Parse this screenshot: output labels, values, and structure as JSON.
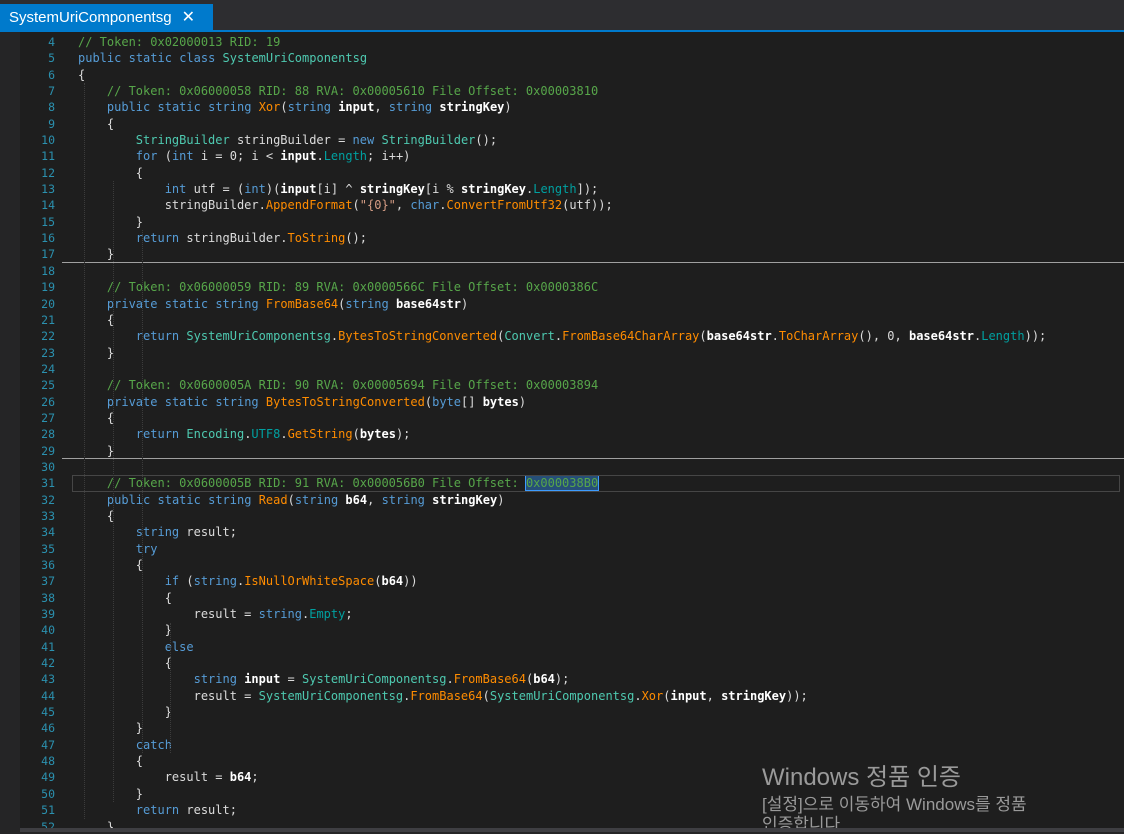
{
  "tab": {
    "title": "SystemUriComponentsg",
    "close_glyph": "✕"
  },
  "colors": {
    "keyword": "#569cd6",
    "comment": "#57a64a",
    "type": "#4ec9b0",
    "method": "#ff8c00",
    "string": "#d69d85",
    "property": "#00a0a0",
    "accent": "#007acc",
    "line_number": "#2b91af"
  },
  "code_lines": [
    {
      "n": "4",
      "t": "// Token: 0x02000013 RID: 19"
    },
    {
      "n": "5",
      "t": "public static class SystemUriComponentsg"
    },
    {
      "n": "6",
      "t": "{"
    },
    {
      "n": "7",
      "t": "    // Token: 0x06000058 RID: 88 RVA: 0x00005610 File Offset: 0x00003810"
    },
    {
      "n": "8",
      "t": "    public static string Xor(string input, string stringKey)"
    },
    {
      "n": "9",
      "t": "    {"
    },
    {
      "n": "10",
      "t": "        StringBuilder stringBuilder = new StringBuilder();"
    },
    {
      "n": "11",
      "t": "        for (int i = 0; i < input.Length; i++)"
    },
    {
      "n": "12",
      "t": "        {"
    },
    {
      "n": "13",
      "t": "            int utf = (int)(input[i] ^ stringKey[i % stringKey.Length]);"
    },
    {
      "n": "14",
      "t": "            stringBuilder.AppendFormat(\"{0}\", char.ConvertFromUtf32(utf));"
    },
    {
      "n": "15",
      "t": "        }"
    },
    {
      "n": "16",
      "t": "        return stringBuilder.ToString();"
    },
    {
      "n": "17",
      "t": "    }"
    },
    {
      "n": "18",
      "t": ""
    },
    {
      "n": "19",
      "t": "    // Token: 0x06000059 RID: 89 RVA: 0x0000566C File Offset: 0x0000386C"
    },
    {
      "n": "20",
      "t": "    private static string FromBase64(string base64str)"
    },
    {
      "n": "21",
      "t": "    {"
    },
    {
      "n": "22",
      "t": "        return SystemUriComponentsg.BytesToStringConverted(Convert.FromBase64CharArray(base64str.ToCharArray(), 0, base64str.Length));"
    },
    {
      "n": "23",
      "t": "    }"
    },
    {
      "n": "24",
      "t": ""
    },
    {
      "n": "25",
      "t": "    // Token: 0x0600005A RID: 90 RVA: 0x00005694 File Offset: 0x00003894"
    },
    {
      "n": "26",
      "t": "    private static string BytesToStringConverted(byte[] bytes)"
    },
    {
      "n": "27",
      "t": "    {"
    },
    {
      "n": "28",
      "t": "        return Encoding.UTF8.GetString(bytes);"
    },
    {
      "n": "29",
      "t": "    }"
    },
    {
      "n": "30",
      "t": ""
    },
    {
      "n": "31",
      "t": "    // Token: 0x0600005B RID: 91 RVA: 0x000056B0 File Offset: 0x000038B0"
    },
    {
      "n": "32",
      "t": "    public static string Read(string b64, string stringKey)"
    },
    {
      "n": "33",
      "t": "    {"
    },
    {
      "n": "34",
      "t": "        string result;"
    },
    {
      "n": "35",
      "t": "        try"
    },
    {
      "n": "36",
      "t": "        {"
    },
    {
      "n": "37",
      "t": "            if (string.IsNullOrWhiteSpace(b64))"
    },
    {
      "n": "38",
      "t": "            {"
    },
    {
      "n": "39",
      "t": "                result = string.Empty;"
    },
    {
      "n": "40",
      "t": "            }"
    },
    {
      "n": "41",
      "t": "            else"
    },
    {
      "n": "42",
      "t": "            {"
    },
    {
      "n": "43",
      "t": "                string input = SystemUriComponentsg.FromBase64(b64);"
    },
    {
      "n": "44",
      "t": "                result = SystemUriComponentsg.FromBase64(SystemUriComponentsg.Xor(input, stringKey));"
    },
    {
      "n": "45",
      "t": "            }"
    },
    {
      "n": "46",
      "t": "        }"
    },
    {
      "n": "47",
      "t": "        catch"
    },
    {
      "n": "48",
      "t": "        {"
    },
    {
      "n": "49",
      "t": "            result = b64;"
    },
    {
      "n": "50",
      "t": "        }"
    },
    {
      "n": "51",
      "t": "        return result;"
    },
    {
      "n": "52",
      "t": "    }"
    }
  ],
  "selected_text": "0x000038B0",
  "watermark": {
    "title": "Windows 정품 인증",
    "line1": "[설정]으로 이동하여 Windows를 정품",
    "line2": "인증합니다."
  }
}
